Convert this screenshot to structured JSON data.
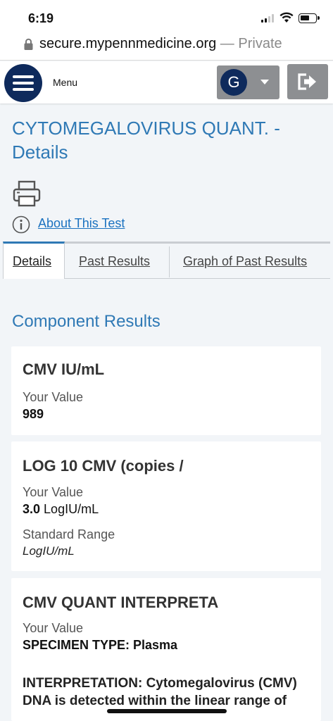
{
  "status_bar": {
    "time": "6:19"
  },
  "browser": {
    "url": "secure.mypennmedicine.org",
    "separator": " — ",
    "mode": "Private"
  },
  "header": {
    "menu_label": "Menu",
    "avatar_initial": "G"
  },
  "page": {
    "title": "CYTOMEGALOVIRUS QUANT. - Details",
    "about_link": "About This Test",
    "tabs": [
      {
        "label": "Details",
        "active": true
      },
      {
        "label": "Past Results",
        "active": false
      },
      {
        "label": "Graph of Past Results",
        "active": false
      }
    ],
    "section_title": "Component Results"
  },
  "components": [
    {
      "name": "CMV IU/mL",
      "your_value_label": "Your Value",
      "value": "989"
    },
    {
      "name": "LOG 10 CMV (copies /",
      "your_value_label": "Your Value",
      "value": "3.0",
      "unit": "LogIU/mL",
      "range_label": "Standard Range",
      "range": "LogIU/mL"
    },
    {
      "name": "CMV QUANT INTERPRETA",
      "your_value_label": "Your Value",
      "value": "SPECIMEN TYPE: Plasma",
      "interpretation": "INTERPRETATION: Cytomegalovirus (CMV) DNA is detected within the linear range of"
    }
  ]
}
